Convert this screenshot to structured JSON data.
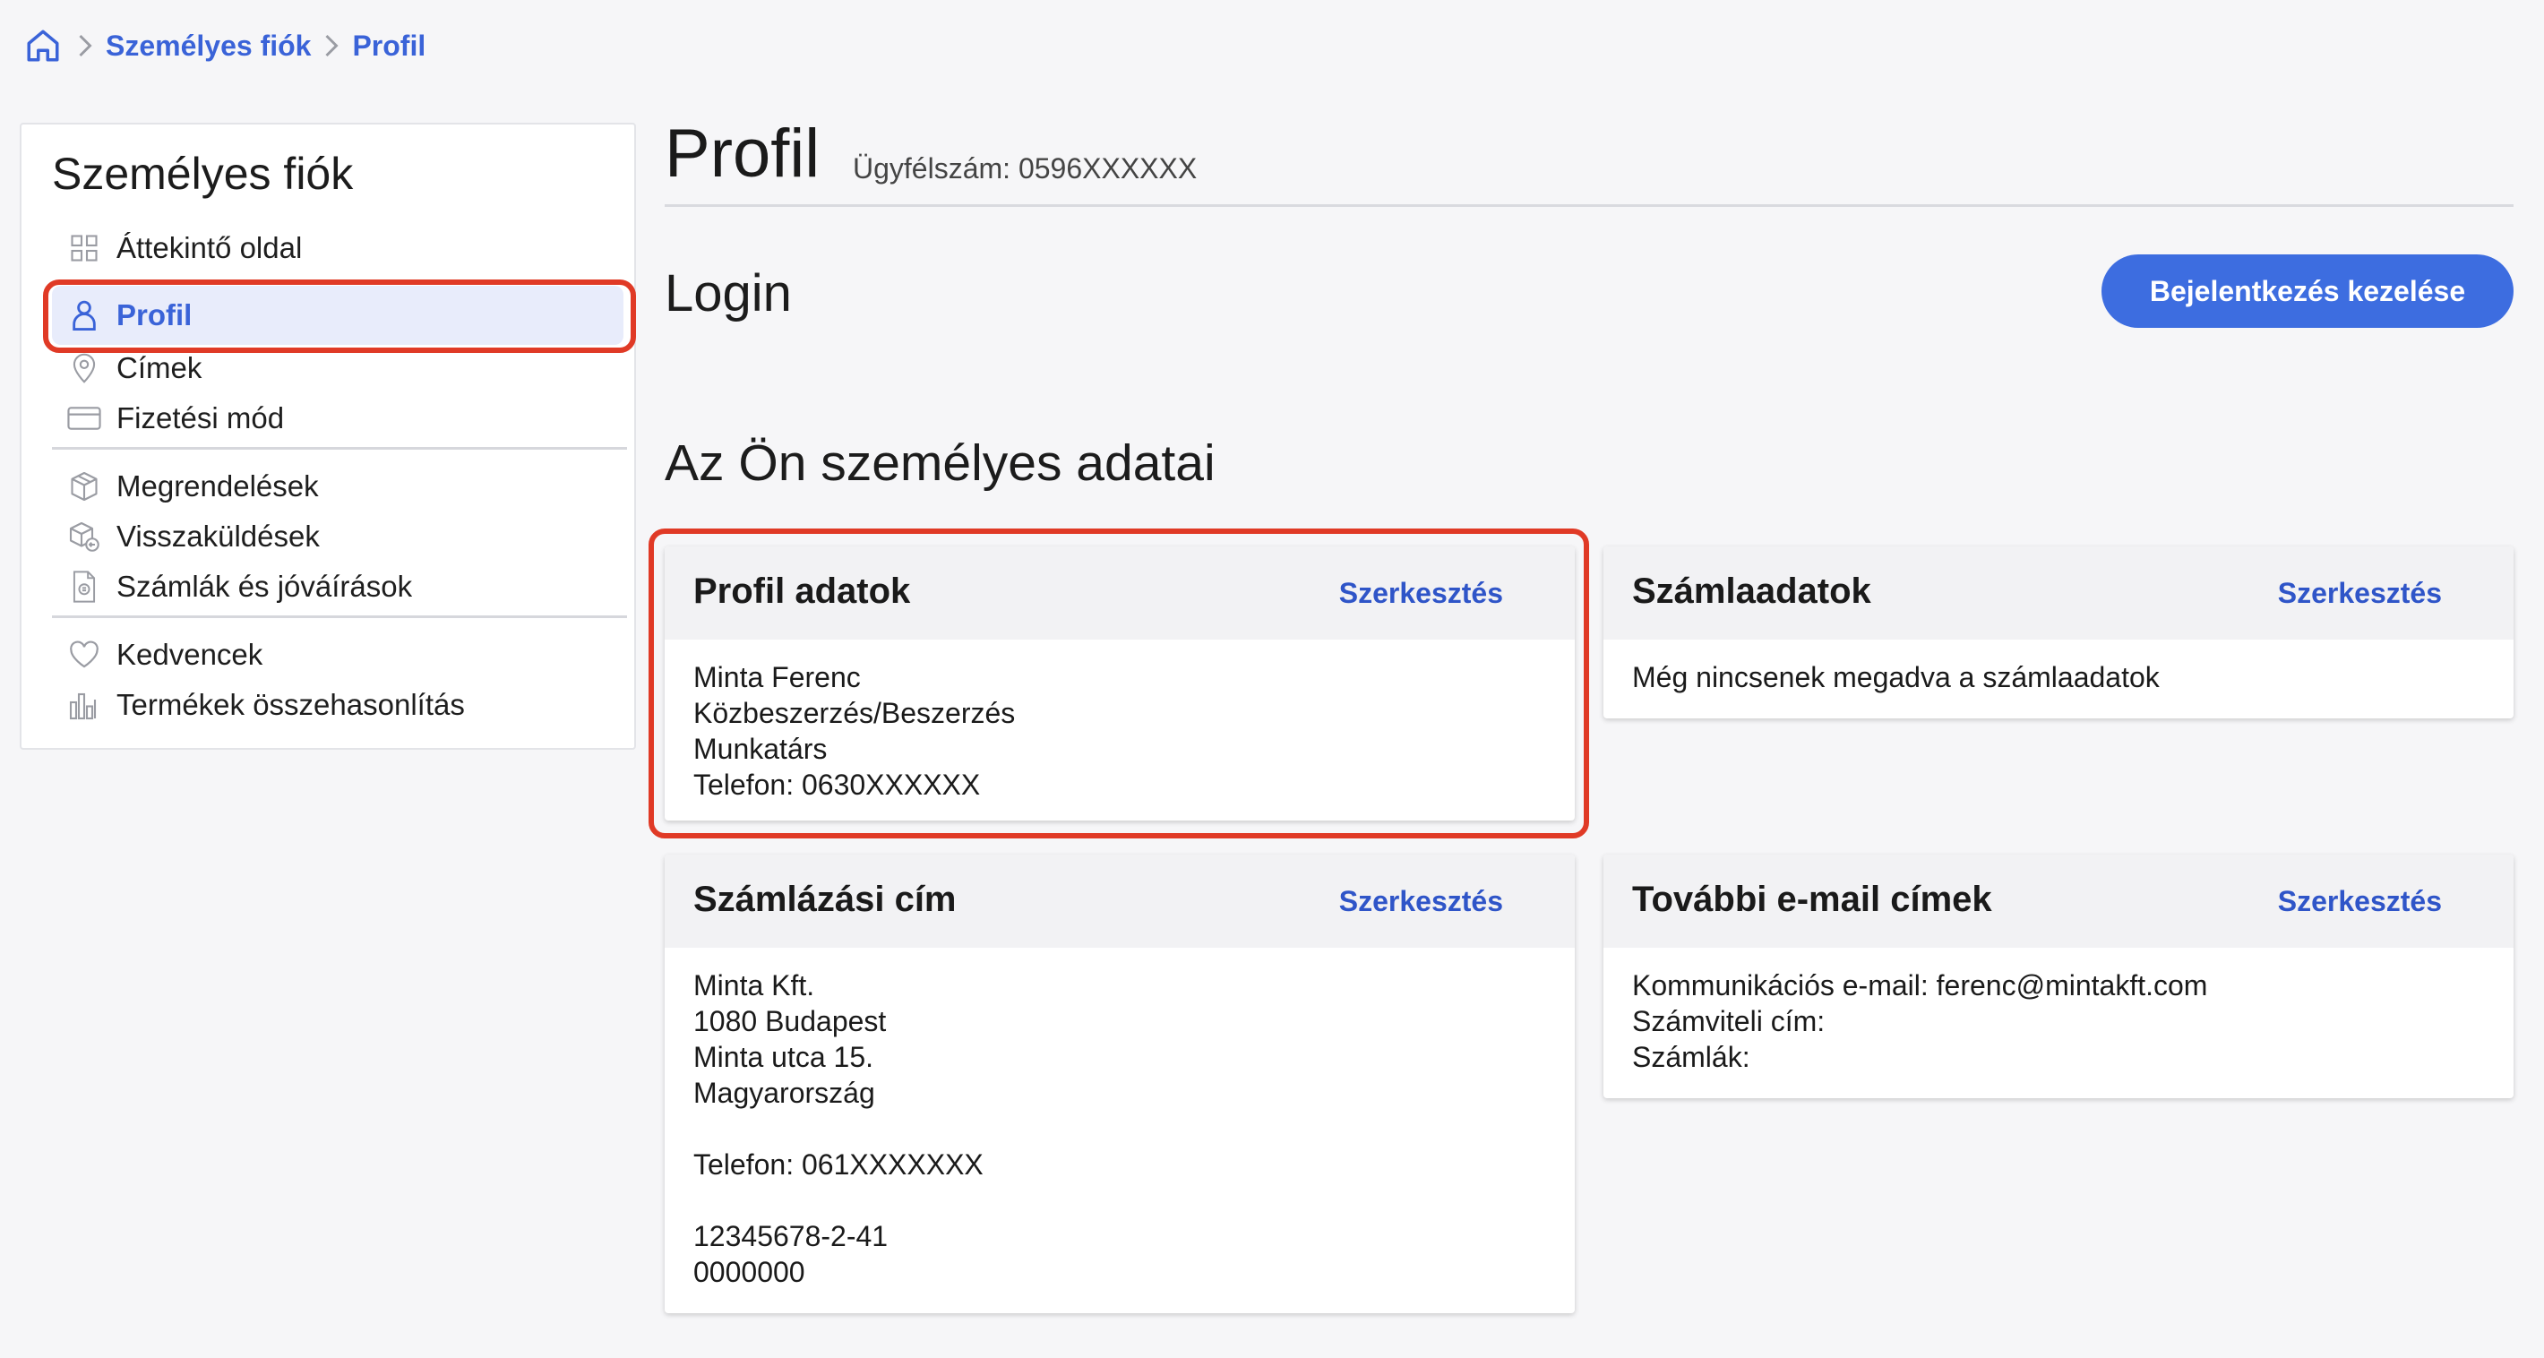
{
  "breadcrumb": {
    "home_icon": "home-icon",
    "items": [
      "Személyes fiók",
      "Profil"
    ]
  },
  "sidebar": {
    "title": "Személyes fiók",
    "items": [
      {
        "label": "Áttekintő oldal",
        "icon": "grid-icon"
      },
      {
        "label": "Profil",
        "icon": "user-icon",
        "active": true
      },
      {
        "label": "Címek",
        "icon": "location-pin-icon"
      },
      {
        "label": "Fizetési mód",
        "icon": "credit-card-icon"
      },
      {
        "label": "Megrendelések",
        "icon": "box-icon"
      },
      {
        "label": "Visszaküldések",
        "icon": "return-box-icon"
      },
      {
        "label": "Számlák és jóváírások",
        "icon": "invoice-icon"
      },
      {
        "label": "Kedvencek",
        "icon": "heart-icon"
      },
      {
        "label": "Termékek összehasonlítás",
        "icon": "bar-chart-icon"
      }
    ]
  },
  "header": {
    "title": "Profil",
    "customer_number": "Ügyfélszám: 0596XXXXXX"
  },
  "login": {
    "title": "Login",
    "button_label": "Bejelentkezés kezelése"
  },
  "personal": {
    "title": "Az Ön személyes adatai",
    "cards": {
      "profile": {
        "title": "Profil adatok",
        "edit_label": "Szerkesztés",
        "lines": [
          "Minta Ferenc",
          "Közbeszerzés/Beszerzés",
          "Munkatárs",
          "Telefon: 0630XXXXXX"
        ]
      },
      "billing_data": {
        "title": "Számlaadatok",
        "edit_label": "Szerkesztés",
        "lines": [
          "Még nincsenek megadva a számlaadatok"
        ]
      },
      "billing_address": {
        "title": "Számlázási cím",
        "edit_label": "Szerkesztés",
        "lines": [
          "Minta Kft.",
          "1080 Budapest",
          "Minta utca 15.",
          "Magyarország",
          "",
          "Telefon: 061XXXXXXX",
          "",
          "12345678-2-41",
          "0000000"
        ]
      },
      "emails": {
        "title": "További e-mail címek",
        "edit_label": "Szerkesztés",
        "lines": [
          "Kommunikációs e-mail: ferenc@mintakft.com",
          "Számviteli cím:",
          "Számlák:"
        ]
      }
    }
  },
  "colors": {
    "accent": "#3a63d8",
    "button": "#3d6de0",
    "highlight": "#e03a26"
  }
}
